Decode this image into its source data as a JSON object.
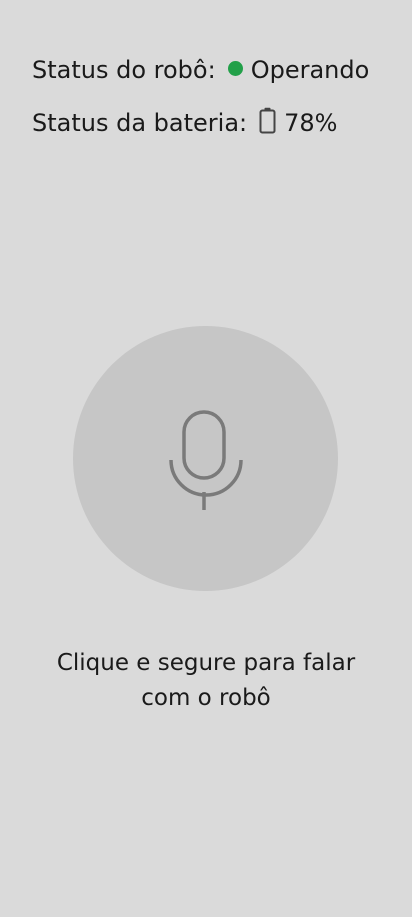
{
  "status": {
    "robot_label": "Status do robô:",
    "robot_value": "Operando",
    "robot_indicator_color": "#22a049",
    "battery_label": "Status da bateria:",
    "battery_icon": "battery-icon",
    "battery_value": "78%"
  },
  "mic": {
    "icon": "microphone-icon"
  },
  "instructions": {
    "line1": "Clique e segure para falar",
    "line2": "com o robô"
  }
}
